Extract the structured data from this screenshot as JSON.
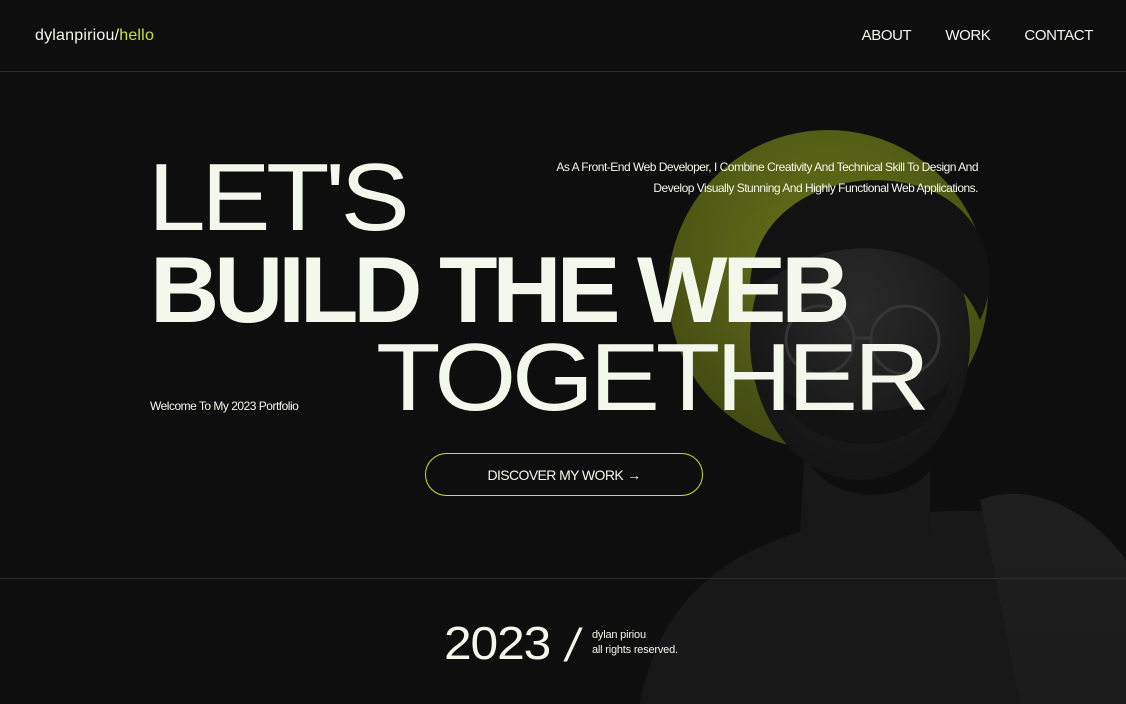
{
  "header": {
    "logo_main": "dylanpiriou/",
    "logo_accent": "hello",
    "nav": [
      {
        "label": "ABOUT"
      },
      {
        "label": "WORK"
      },
      {
        "label": "CONTACT"
      }
    ]
  },
  "hero": {
    "line1": "LET'S",
    "line2": "BUILD THE WEB",
    "line3": "TOGETHER",
    "intro_line1": "As A Front-End Web Developer, I Combine Creativity And Technical Skill To Design And",
    "intro_line2": "Develop Visually Stunning And Highly Functional Web Applications.",
    "welcome": "Welcome To My 2023 Portfolio",
    "cta_label": "DISCOVER MY WORK",
    "cta_icon": "arrow-right-icon"
  },
  "footer": {
    "year": "2023",
    "slash": "/",
    "name": "dylan piriou",
    "rights": "all rights reserved."
  },
  "colors": {
    "background": "#0e0e0e",
    "text": "#f4f7ec",
    "accent": "#c2e534",
    "circle": "#5f6b19"
  }
}
